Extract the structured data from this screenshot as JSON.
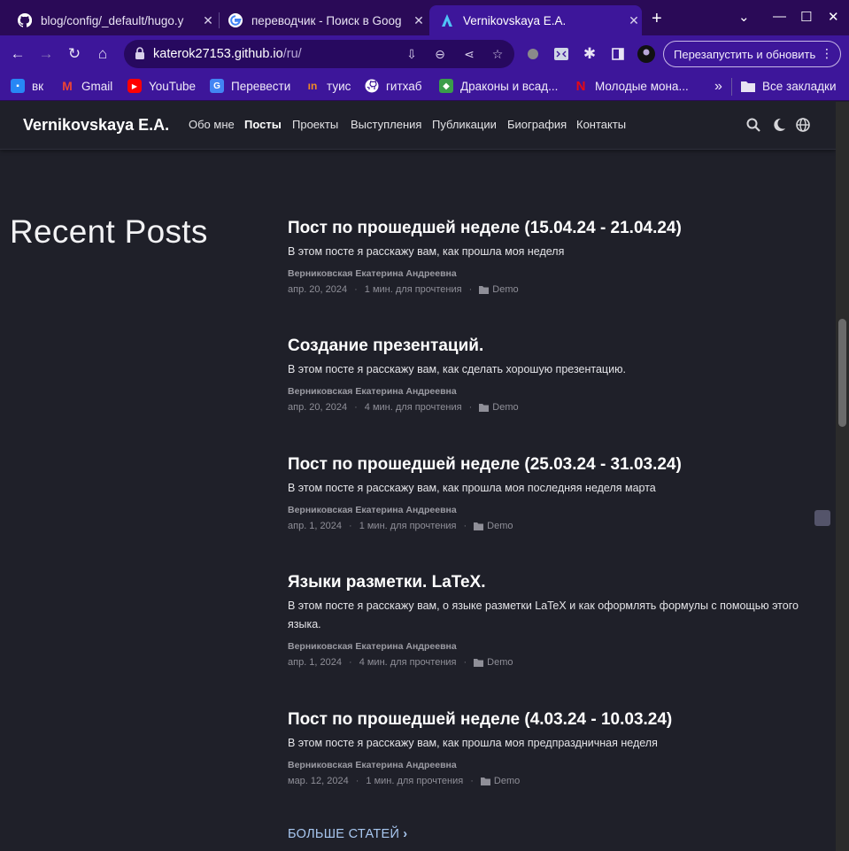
{
  "browser": {
    "tabs": [
      {
        "title": "blog/config/_default/hugo.y",
        "icon": "github-icon",
        "active": false
      },
      {
        "title": "переводчик - Поиск в Goog",
        "icon": "google-icon",
        "active": false
      },
      {
        "title": "Vernikovskaya E.A.",
        "icon": "hugo-blox-icon",
        "active": true
      }
    ],
    "url": {
      "host": "katerok27153.github.io",
      "path": "/ru/"
    },
    "relaunch_label": "Перезапустить и обновить",
    "bookmarks": [
      {
        "label": "вк",
        "icon": "vk-icon",
        "color": "#2787f5"
      },
      {
        "label": "Gmail",
        "icon": "gmail-icon",
        "color": "#ea4335"
      },
      {
        "label": "YouTube",
        "icon": "youtube-icon",
        "color": "#ff0000"
      },
      {
        "label": "Перевести",
        "icon": "google-translate-icon",
        "color": "#4285f4"
      },
      {
        "label": "туис",
        "icon": "tuis-icon",
        "color": "#f08a24"
      },
      {
        "label": "гитхаб",
        "icon": "github-icon",
        "color": "#ffffff"
      },
      {
        "label": "Драконы и всад...",
        "icon": "dragons-icon",
        "color": "#3a9d4a"
      },
      {
        "label": "Молодые мона...",
        "icon": "netflix-icon",
        "color": "#e50914"
      }
    ],
    "all_bookmarks_label": "Все закладки"
  },
  "site": {
    "brand": "Vernikovskaya E.A.",
    "nav": [
      {
        "label": "Обо мне",
        "active": false
      },
      {
        "label": "Посты",
        "active": true
      },
      {
        "label": "Проекты",
        "active": false
      },
      {
        "label": "Выступления",
        "active": false
      },
      {
        "label": "Публикации",
        "active": false
      },
      {
        "label": "Биография",
        "active": false
      },
      {
        "label": "Контакты",
        "active": false
      }
    ]
  },
  "main": {
    "section_title": "Recent Posts",
    "posts": [
      {
        "title": "Пост по прошедшей неделе (15.04.24 - 21.04.24)",
        "summary": "В этом посте я расскажу вам, как прошла моя неделя",
        "author": "Верниковская Екатерина Андреевна",
        "date": "апр. 20, 2024",
        "reading_time": "1 мин. для прочтения",
        "category": "Demo"
      },
      {
        "title": "Создание презентаций.",
        "summary": "В этом посте я расскажу вам, как сделать хорошую презентацию.",
        "author": "Верниковская Екатерина Андреевна",
        "date": "апр. 20, 2024",
        "reading_time": "4 мин. для прочтения",
        "category": "Demo"
      },
      {
        "title": "Пост по прошедшей неделе (25.03.24 - 31.03.24)",
        "summary": "В этом посте я расскажу вам, как прошла моя последняя неделя марта",
        "author": "Верниковская Екатерина Андреевна",
        "date": "апр. 1, 2024",
        "reading_time": "1 мин. для прочтения",
        "category": "Demo"
      },
      {
        "title": "Языки разметки. LaTeX.",
        "summary": "В этом посте я расскажу вам, о языке разметки LaTeX и как оформлять формулы с помощью этого языка.",
        "author": "Верниковская Екатерина Андреевна",
        "date": "апр. 1, 2024",
        "reading_time": "4 мин. для прочтения",
        "category": "Demo"
      },
      {
        "title": "Пост по прошедшей неделе (4.03.24 - 10.03.24)",
        "summary": "В этом посте я расскажу вам, как прошла моя предпраздничная неделя",
        "author": "Верниковская Екатерина Андреевна",
        "date": "мар. 12, 2024",
        "reading_time": "1 мин. для прочтения",
        "category": "Demo"
      }
    ],
    "more_label": "БОЛЬШЕ СТАТЕЙ"
  }
}
